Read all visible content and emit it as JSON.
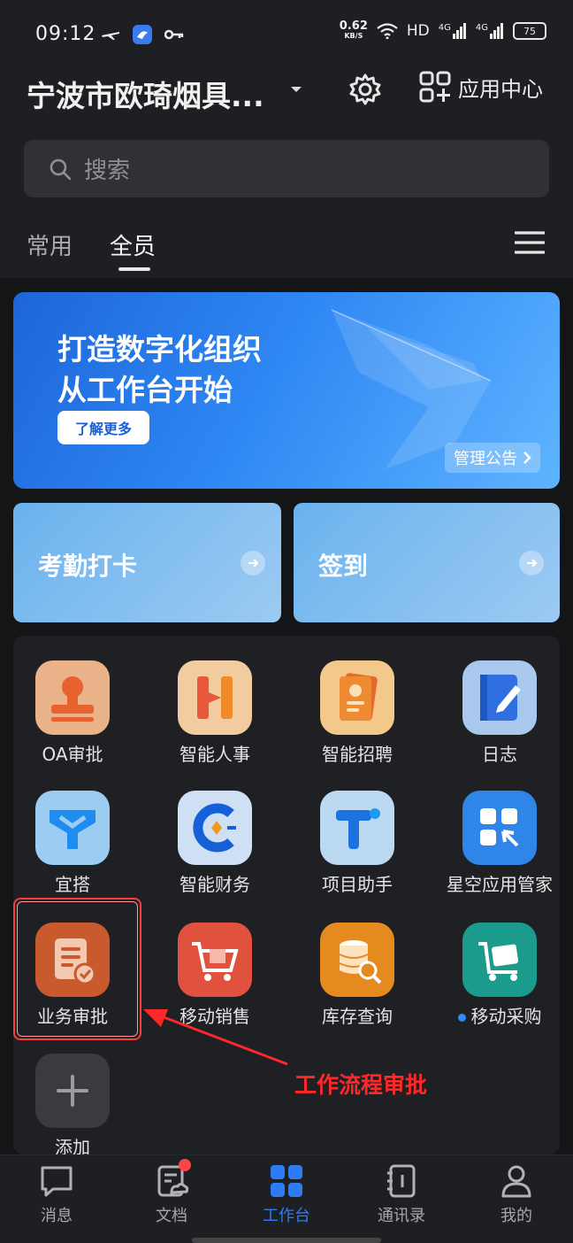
{
  "status": {
    "time": "09:12",
    "net_speed": "0.62",
    "net_unit": "KB/S",
    "hd_label": "HD",
    "signal1": "4G",
    "signal2": "4G",
    "battery": "75"
  },
  "header": {
    "org_name": "宁波市欧琦烟具...",
    "app_center_label": "应用中心"
  },
  "search": {
    "placeholder": "搜索"
  },
  "tabs": [
    {
      "label": "常用",
      "active": false
    },
    {
      "label": "全员",
      "active": true
    }
  ],
  "banner": {
    "title_line1": "打造数字化组织",
    "title_line2": "从工作台开始",
    "button_label": "了解更多",
    "notice_label": "管理公告"
  },
  "quick_actions": [
    {
      "label": "考勤打卡"
    },
    {
      "label": "签到"
    }
  ],
  "apps": [
    {
      "label": "OA审批",
      "icon": "stamp-icon",
      "color": "#e9b289"
    },
    {
      "label": "智能人事",
      "icon": "h-letter-icon",
      "color": "#f2cc9e"
    },
    {
      "label": "智能招聘",
      "icon": "resume-card-icon",
      "color": "#f3c88a"
    },
    {
      "label": "日志",
      "icon": "notebook-pen-icon",
      "color": "#a9c8ee"
    },
    {
      "label": "宜搭",
      "icon": "y-block-icon",
      "color": "#9bcdf3"
    },
    {
      "label": "智能财务",
      "icon": "finance-c-icon",
      "color": "#cfe0f5"
    },
    {
      "label": "项目助手",
      "icon": "t-letter-icon",
      "color": "#bcd9f2"
    },
    {
      "label": "星空应用管家",
      "icon": "app-grid-icon",
      "color": "#2f86e8"
    },
    {
      "label": "业务审批",
      "icon": "document-check-icon",
      "color": "#c85a2e"
    },
    {
      "label": "移动销售",
      "icon": "shopping-cart-icon",
      "color": "#e0523e"
    },
    {
      "label": "库存查询",
      "icon": "database-search-icon",
      "color": "#e48a1f"
    },
    {
      "label": "移动采购",
      "icon": "cart-box-icon",
      "color": "#1a9b8c",
      "dot": true
    },
    {
      "label": "添加",
      "icon": "plus-icon",
      "color": "#3a3b40"
    }
  ],
  "annotation": {
    "text": "工作流程审批"
  },
  "tabbar": [
    {
      "label": "消息",
      "icon": "chat-bubble-icon",
      "active": false
    },
    {
      "label": "文档",
      "icon": "document-cloud-icon",
      "active": false,
      "badge": true
    },
    {
      "label": "工作台",
      "icon": "workbench-grid-icon",
      "active": true
    },
    {
      "label": "通讯录",
      "icon": "contacts-book-icon",
      "active": false
    },
    {
      "label": "我的",
      "icon": "person-icon",
      "active": false
    }
  ],
  "colors": {
    "accent": "#2d7cf6",
    "annotation_red": "#ff2727",
    "background": "#1e1f22"
  }
}
